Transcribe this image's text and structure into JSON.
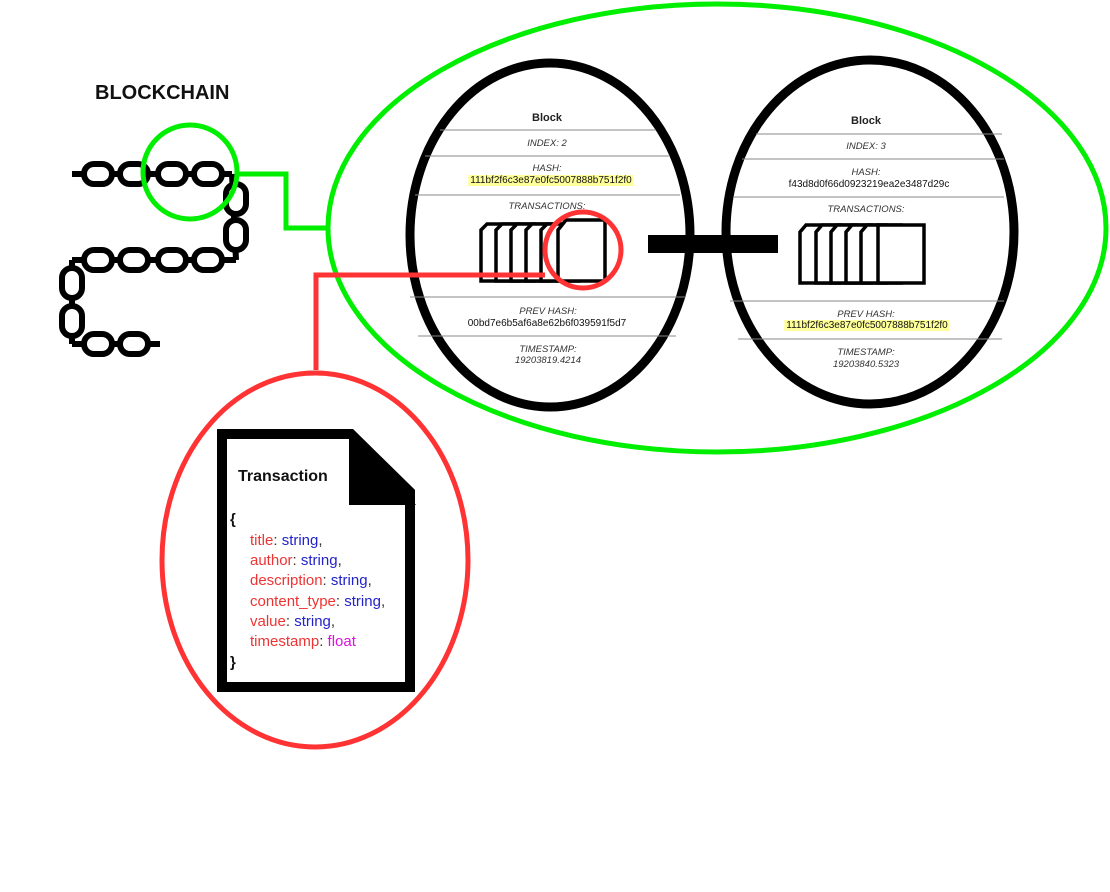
{
  "diagram": {
    "title": "BLOCKCHAIN",
    "blocks": [
      {
        "heading": "Block",
        "index_label": "INDEX: 2",
        "hash_label": "HASH:",
        "hash": "111bf2f6c3e87e0fc5007888b751f2f0",
        "transactions_label": "TRANSACTIONS:",
        "prev_hash_label": "PREV HASH:",
        "prev_hash": "00bd7e6b5af6a8e62b6f039591f5d7",
        "timestamp_label": "TIMESTAMP:",
        "timestamp": "19203819.4214"
      },
      {
        "heading": "Block",
        "index_label": "INDEX: 3",
        "hash_label": "HASH:",
        "hash": "f43d8d0f66d0923219ea2e3487d29c",
        "transactions_label": "TRANSACTIONS:",
        "prev_hash_label": "PREV HASH:",
        "prev_hash": "111bf2f6c3e87e0fc5007888b751f2f0",
        "timestamp_label": "TIMESTAMP:",
        "timestamp": "19203840.5323"
      }
    ],
    "transaction": {
      "title": "Transaction",
      "open_brace": "{",
      "close_brace": "}",
      "fields": [
        {
          "key": "title",
          "type": "string"
        },
        {
          "key": "author",
          "type": "string"
        },
        {
          "key": "description",
          "type": "string"
        },
        {
          "key": "content_type",
          "type": "string"
        },
        {
          "key": "value",
          "type": "string"
        },
        {
          "key": "timestamp",
          "type": "float"
        }
      ]
    },
    "colors": {
      "highlight_green": "#00ee00",
      "highlight_red": "#ff3333",
      "key_red": "#ee3333",
      "type_blue": "#2222cc",
      "type_magenta": "#dd11dd",
      "hash_highlight": "#ffff99",
      "ink": "#000000"
    }
  }
}
